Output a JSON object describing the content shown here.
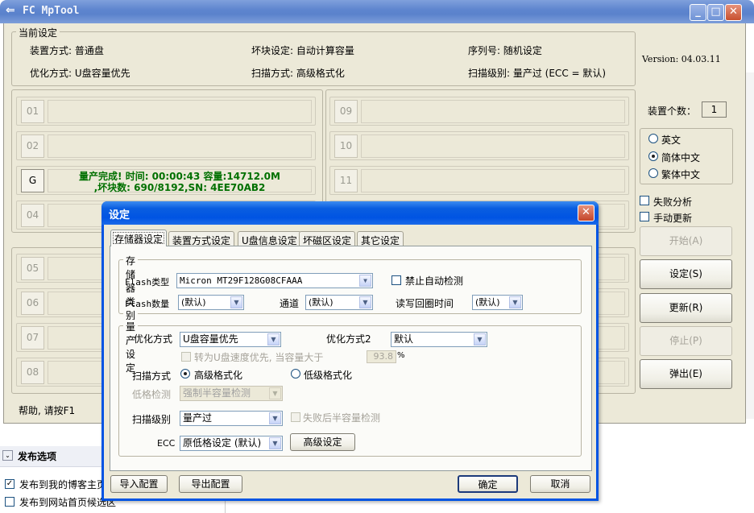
{
  "main": {
    "title": "FC MpTool",
    "version": "Version: 04.03.11",
    "settings_group": "当前设定",
    "settings": {
      "device_mode": "装置方式: 普通盘",
      "bad_block": "坏块设定: 自动计算容量",
      "serial": "序列号: 随机设定",
      "optimize": "优化方式: U盘容量优先",
      "scan": "扫描方式: 高级格式化",
      "scan_level": "扫描级别: 量产过 (ECC = 默认)"
    },
    "slots_left": [
      "01",
      "02",
      "G",
      "04",
      "05",
      "06",
      "07",
      "08"
    ],
    "slots_right": [
      "09",
      "10",
      "11"
    ],
    "active_status": {
      "line1": "量产完成! 时间: 00:00:43 容量:14712.0M",
      "line2": ",坏块数: 690/8192,SN: 4EE70AB2"
    },
    "help": "帮助, 请按F1",
    "device_count_label": "装置个数：",
    "device_count": "1",
    "languages": [
      "英文",
      "简体中文",
      "繁体中文"
    ],
    "fail_analysis": "失败分析",
    "manual_update": "手动更新",
    "buttons": {
      "start": "开始(A)",
      "settings": "设定(S)",
      "update": "更新(R)",
      "stop": "停止(P)",
      "eject": "弹出(E)"
    },
    "accent": "#5a82cc",
    "status_color": "#007000"
  },
  "background": {
    "publish_title": "发布选项",
    "publish_blog": "发布到我的博客主页",
    "publish_site": "发布到网站首页候选区"
  },
  "dialog": {
    "title": "设定",
    "tabs": [
      "存储器设定",
      "装置方式设定",
      "U盘信息设定",
      "坏磁区设定",
      "其它设定"
    ],
    "storage": {
      "group": "存储器类别",
      "flash_type_label": "Flash类型",
      "flash_type": "Micron MT29F128G08CFAAA",
      "disable_auto": "禁止自动检测",
      "flash_count_label": "Flash数量",
      "flash_count": "(默认)",
      "channel_label": "通道",
      "channel": "(默认)",
      "readback_label": "读写回圈时间",
      "readback": "(默认)"
    },
    "production": {
      "group": "量产设定",
      "opt_label": "优化方式",
      "opt": "U盘容量优先",
      "opt2_label": "优化方式2",
      "opt2": "默认",
      "speed_pref": "转为U盘速度优先, 当容量大于",
      "speed_val": "93.8",
      "percent": "%",
      "scan_label": "扫描方式",
      "scan_hi": "高级格式化",
      "scan_lo": "低级格式化",
      "low_check_label": "低格检测",
      "low_check": "强制半容量检测",
      "scan_level_label": "扫描级别",
      "scan_level": "量产过",
      "fail_half": "失败后半容量检测",
      "ecc_label": "ECC",
      "ecc": "原低格设定 (默认)",
      "advanced": "高级设定"
    },
    "buttons": {
      "import": "导入配置",
      "export": "导出配置",
      "ok": "确定",
      "cancel": "取消"
    }
  }
}
